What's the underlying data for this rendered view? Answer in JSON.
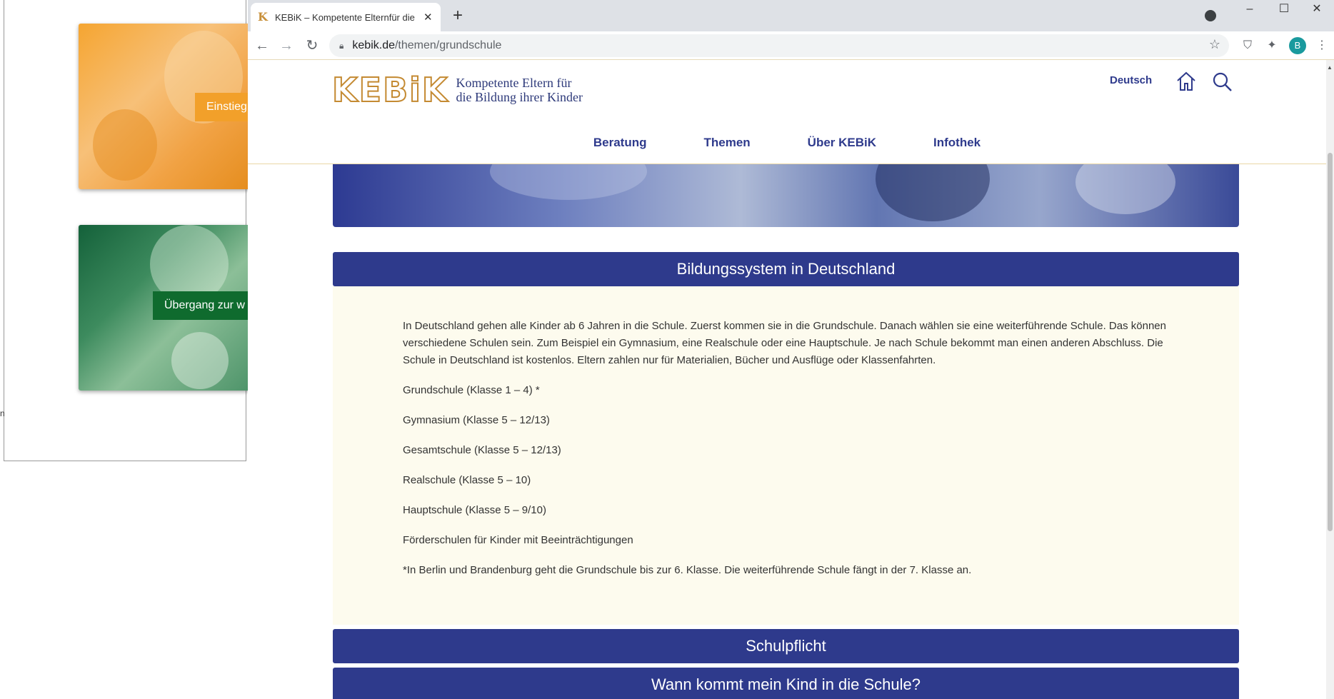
{
  "background": {
    "cards": [
      {
        "label": "Einstieg",
        "color": "#f2a02a"
      },
      {
        "label": "Übergang zur w",
        "color": "#0f6b2e"
      }
    ],
    "stray_char": "n"
  },
  "browser": {
    "tab_title": "KEBiK – Kompetente Elternfür die Bildung ihrer Kinder",
    "tab_close": "✕",
    "new_tab": "+",
    "minimize": "–",
    "maximize": "☐",
    "close": "✕",
    "url_host": "kebik.de",
    "url_path": "/themen/grundschule",
    "avatar_letter": "B"
  },
  "site": {
    "logo_mark": "KEBiK",
    "logo_line1": "Kompetente Eltern für",
    "logo_line2": "die Bildung ihrer Kinder",
    "language": "Deutsch",
    "nav": [
      "Beratung",
      "Themen",
      "Über KEBiK",
      "Infothek"
    ],
    "brand_color": "#2e3a8c",
    "accent_color": "#c48a32"
  },
  "accordion": {
    "section1_title": "Bildungssystem in Deutschland",
    "section1_intro": "In Deutschland gehen alle Kinder ab 6 Jahren in die Schule. Zuerst kommen sie in die Grundschule. Danach wählen sie eine weiterführende Schule. Das können verschiedene Schulen sein. Zum Beispiel ein Gymnasium, eine Realschule oder eine Hauptschule. Je nach Schule bekommt man einen anderen Abschluss. Die Schule in Deutschland ist kostenlos. Eltern zahlen nur für Materialien, Bücher und Ausflüge oder Klassenfahrten.",
    "school_types": [
      "Grundschule (Klasse 1 – 4) *",
      "Gymnasium (Klasse 5 – 12/13)",
      "Gesamtschule (Klasse 5 – 12/13)",
      "Realschule (Klasse 5 – 10)",
      "Hauptschule (Klasse 5 – 9/10)",
      "Förderschulen für Kinder mit Beeinträchtigungen"
    ],
    "footnote": "*In Berlin und Brandenburg geht die Grundschule bis zur 6. Klasse. Die weiterführende Schule fängt in der 7. Klasse an.",
    "section2_title": "Schulpflicht",
    "section3_title": "Wann kommt mein Kind in die Schule?"
  }
}
